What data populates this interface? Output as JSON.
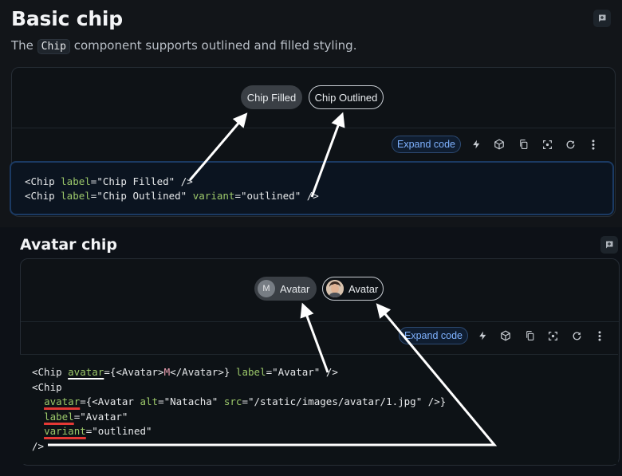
{
  "basic": {
    "title": "Basic chip",
    "desc_before": "The ",
    "desc_code": "Chip",
    "desc_after": " component supports outlined and filled styling.",
    "chip_filled": "Chip Filled",
    "chip_outlined": "Chip Outlined",
    "expand_label": "Expand code",
    "code": [
      {
        "open": "<Chip ",
        "attr": "label",
        "eq": "=",
        "val": "\"Chip Filled\"",
        "close": " />"
      },
      {
        "open": "<Chip ",
        "attr": "label",
        "eq": "=",
        "val": "\"Chip Outlined\"",
        "sp": " ",
        "attr2": "variant",
        "eq2": "=",
        "val2": "\"outlined\"",
        "close": " />"
      }
    ]
  },
  "avatar": {
    "title": "Avatar chip",
    "chip1_letter": "M",
    "chip1_label": "Avatar",
    "chip2_label": "Avatar",
    "expand_label": "Expand code",
    "code": {
      "l1_open": "<Chip ",
      "l1_attr": "avatar",
      "l1_eq": "={",
      "l1_avatar_open": "<Avatar>",
      "l1_letter": "M",
      "l1_avatar_close": "</Avatar>",
      "l1_rest": "} ",
      "l1_attr2": "label",
      "l1_val2": "=\"Avatar\"",
      "l1_close": " />",
      "l2": "<Chip",
      "l3_attr": "avatar",
      "l3_eq": "={",
      "l3_tag": "<Avatar ",
      "l3_alt": "alt",
      "l3_altval": "=\"Natacha\" ",
      "l3_src": "src",
      "l3_srcval": "=\"/static/images/avatar/1.jpg\"",
      "l3_close": " />}",
      "l4_attr": "label",
      "l4_val": "=\"Avatar\"",
      "l5_attr": "variant",
      "l5_val": "=\"outlined\"",
      "l6": "/>"
    }
  },
  "icons": {
    "comment": "comment-add-icon",
    "toolbar": [
      "bolt-icon",
      "cube-icon",
      "copy-icon",
      "fullscreen-icon",
      "reset-icon",
      "more-vert-icon"
    ]
  },
  "colors": {
    "accent": "#7fb2ff",
    "attr": "#9cc86a",
    "highlight_red": "#e53935",
    "arrow": "#ffffff"
  }
}
